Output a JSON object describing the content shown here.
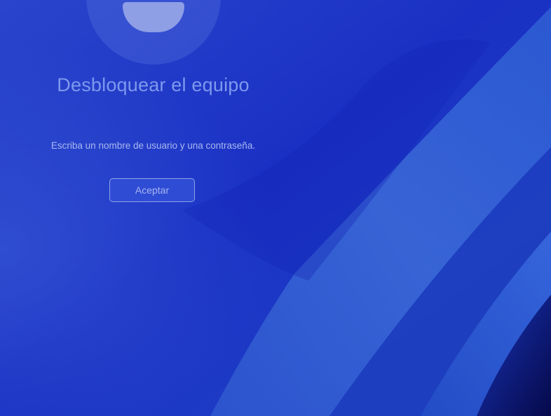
{
  "lock_screen": {
    "title": "Desbloquear el equipo",
    "message": "Escriba un nombre de usuario y una contraseña.",
    "ok_button_label": "Aceptar"
  },
  "theme": {
    "wallpaper_base": "#1a35c8",
    "wallpaper_dark": "#0a0f55",
    "wallpaper_light": "#3a6ad8",
    "title_color": "#7e98ee",
    "text_color": "#a9b7ef",
    "button_border": "#8fa3ee",
    "avatar_color": "#8e9fe6"
  },
  "icons": {
    "avatar": "user-avatar-icon"
  }
}
